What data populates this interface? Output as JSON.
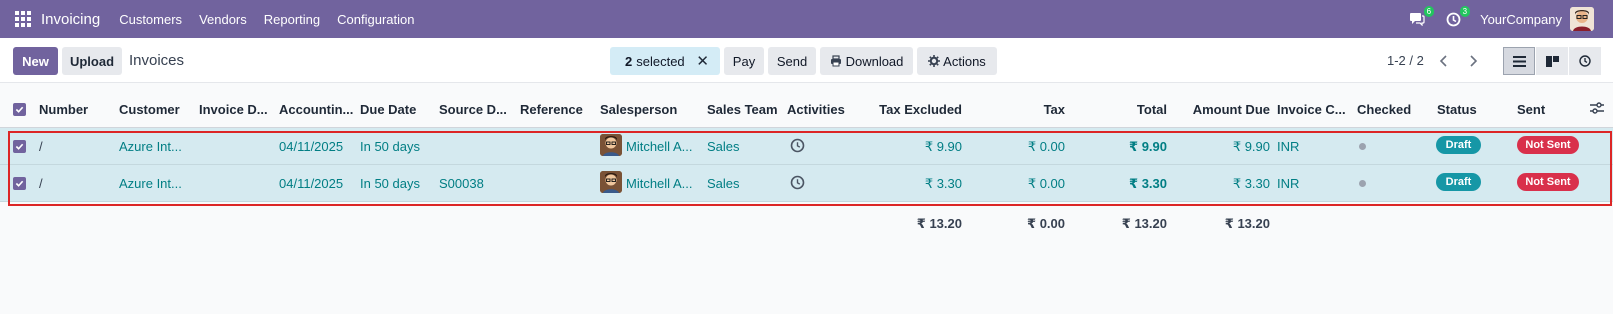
{
  "topbar": {
    "app_name": "Invoicing",
    "menu": [
      "Customers",
      "Vendors",
      "Reporting",
      "Configuration"
    ],
    "messages_badge": "6",
    "activities_badge": "3",
    "company": "YourCompany",
    "color": "#71639e"
  },
  "control": {
    "new_label": "New",
    "upload_label": "Upload",
    "breadcrumb": "Invoices",
    "selected_count": "2",
    "selected_label": "selected",
    "clear_icon": "✕",
    "pay_label": "Pay",
    "send_label": "Send",
    "download_label": "Download",
    "actions_label": "Actions",
    "pager": "1-2 / 2"
  },
  "columns": {
    "number": "Number",
    "customer": "Customer",
    "invoice_date": "Invoice D...",
    "accounting_date": "Accountin...",
    "due_date": "Due Date",
    "source_doc": "Source D...",
    "reference": "Reference",
    "salesperson": "Salesperson",
    "sales_team": "Sales Team",
    "activities": "Activities",
    "tax_excluded": "Tax Excluded",
    "tax": "Tax",
    "total": "Total",
    "amount_due": "Amount Due",
    "invoice_currency": "Invoice C...",
    "checked": "Checked",
    "status": "Status",
    "sent": "Sent"
  },
  "rows": [
    {
      "number": "/",
      "customer": "Azure Int...",
      "accounting_date": "04/11/2025",
      "due_date": "In 50 days",
      "source_doc": "",
      "salesperson": "Mitchell A...",
      "sales_team": "Sales",
      "tax_excluded": "₹ 9.90",
      "tax": "₹ 0.00",
      "total": "₹ 9.90",
      "amount_due": "₹ 9.90",
      "currency": "INR",
      "status": "Draft",
      "sent": "Not Sent"
    },
    {
      "number": "/",
      "customer": "Azure Int...",
      "accounting_date": "04/11/2025",
      "due_date": "In 50 days",
      "source_doc": "S00038",
      "salesperson": "Mitchell A...",
      "sales_team": "Sales",
      "tax_excluded": "₹ 3.30",
      "tax": "₹ 0.00",
      "total": "₹ 3.30",
      "amount_due": "₹ 3.30",
      "currency": "INR",
      "status": "Draft",
      "sent": "Not Sent"
    }
  ],
  "totals": {
    "tax_excluded": "₹ 13.20",
    "tax": "₹ 0.00",
    "total": "₹ 13.20",
    "amount_due": "₹ 13.20"
  }
}
